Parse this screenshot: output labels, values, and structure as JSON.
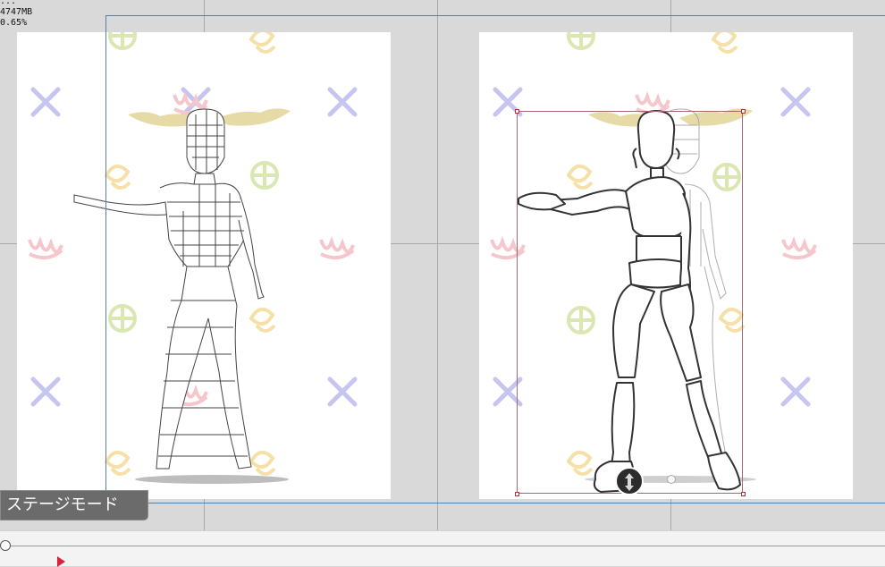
{
  "debug": {
    "line1": "...",
    "memory": "4747MB",
    "zoom": "0.65%"
  },
  "stage_mode": {
    "label": "ステージモード"
  },
  "timeline": {
    "position": 0
  },
  "colors": {
    "workspace": "#d9d9d9",
    "canvas_frame": "#5a7fa0",
    "selection": "#9e6b72",
    "handle": "#b03040",
    "play_marker": "#d8213a",
    "deco_x": "#b4b2ec",
    "deco_w": "#f4b4bd",
    "deco_circle": "#cfe09a",
    "deco_banana": "#f2d88a",
    "antler": "#e6dba6"
  }
}
